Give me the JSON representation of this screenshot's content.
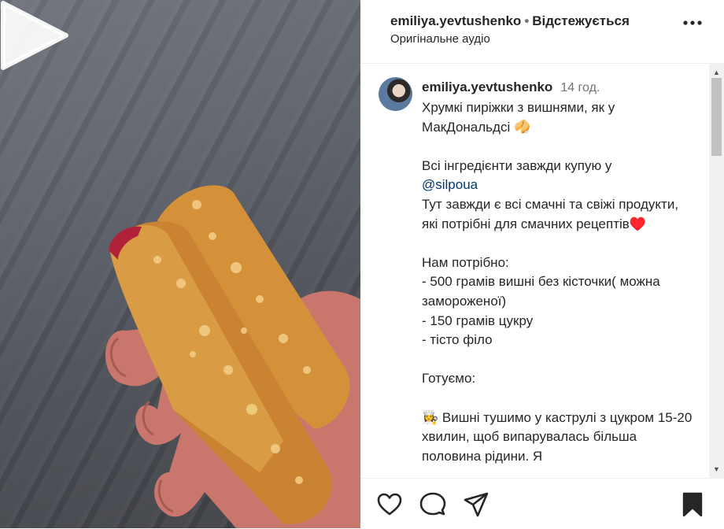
{
  "header": {
    "username": "emiliya.yevtushenko",
    "separator": "•",
    "follow_status": "Відстежується",
    "audio": "Оригінальне аудіо",
    "more_icon": "more-horizontal-icon"
  },
  "caption": {
    "username": "emiliya.yevtushenko",
    "time": "14 год.",
    "text_before": "Хрумкі пиріжки з вишнями, як у МакДональдсі 🥠\n\nВсі інгредієнти завжди купую у\n",
    "mention": "@silpoua",
    "text_after": "\nТут завжди є всі смачні та свіжі продукти, які потрібні для смачних рецептів♥️\n\nНам потрібно:\n- 500 грамів вишні без кісточки( можна замороженої)\n- 150 грамів цукру\n- тісто філо\n\nГотуємо:\n\n👩‍🍳 Вишні тушимо у каструлі з цукром 15-20 хвилин, щоб випарувалась більша половина рідини. Я"
  },
  "actions": {
    "like_icon": "heart-icon",
    "comment_icon": "comment-icon",
    "share_icon": "send-icon",
    "save_icon": "bookmark-icon"
  },
  "media": {
    "play_icon": "play-icon"
  }
}
